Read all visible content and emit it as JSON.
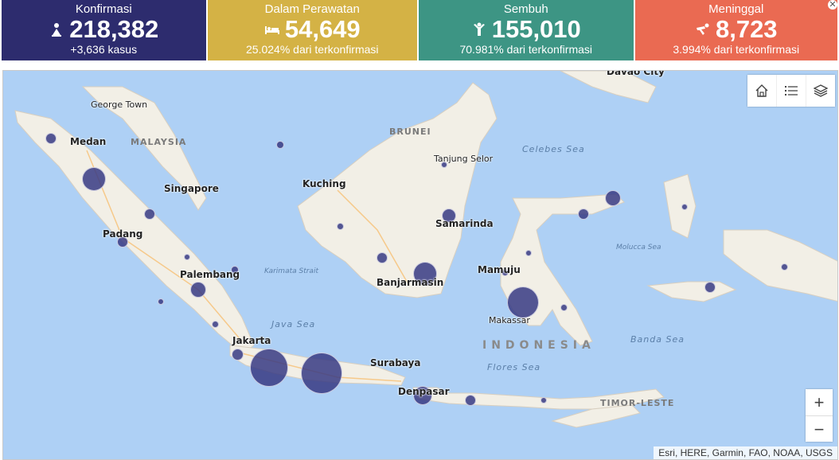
{
  "cards": [
    {
      "label": "Konfirmasi",
      "value": "218,382",
      "sub": "+3,636 kasus",
      "icon": "person-confirmed-icon"
    },
    {
      "label": "Dalam Perawatan",
      "value": "54,649",
      "sub": "25.024% dari terkonfirmasi",
      "icon": "hospital-bed-icon"
    },
    {
      "label": "Sembuh",
      "value": "155,010",
      "sub": "70.981% dari terkonfirmasi",
      "icon": "person-recovered-icon"
    },
    {
      "label": "Meninggal",
      "value": "8,723",
      "sub": "3.994% dari terkonfirmasi",
      "icon": "person-deceased-icon"
    }
  ],
  "colors": {
    "konfirmasi": "#2d2c6e",
    "perawatan": "#d4b245",
    "sembuh": "#3d9584",
    "meninggal": "#ea6a52",
    "bubble": "#373a82",
    "water": "#aed0f5",
    "land": "#f2efe6"
  },
  "map": {
    "labels": {
      "george_town": "George Town",
      "medan": "Medan",
      "malaysia": "MALAYSIA",
      "singapore": "Singapore",
      "padang": "Padang",
      "palembang": "Palembang",
      "jakarta": "Jakarta",
      "java_sea": "Java Sea",
      "karimata": "Karimata Strait",
      "kuching": "Kuching",
      "brunei": "BRUNEI",
      "tanjung_selor": "Tanjung Selor",
      "celebes_sea": "Celebes Sea",
      "samarinda": "Samarinda",
      "banjarmasin": "Banjarmasin",
      "mamuju": "Mamuju",
      "makassar": "Makassar",
      "indonesia": "INDONESIA",
      "flores_sea": "Flores Sea",
      "banda_sea": "Banda Sea",
      "molucca_sea": "Molucca Sea",
      "surabaya": "Surabaya",
      "denpasar": "Denpasar",
      "timor_leste": "TIMOR-LESTE",
      "davao": "Davao City"
    },
    "attribution": "Esri, HERE, Garmin, FAO, NOAA, USGS",
    "tools": [
      "home-icon",
      "legend-list-icon",
      "layers-icon"
    ],
    "zoom_in": "+",
    "zoom_out": "−"
  }
}
